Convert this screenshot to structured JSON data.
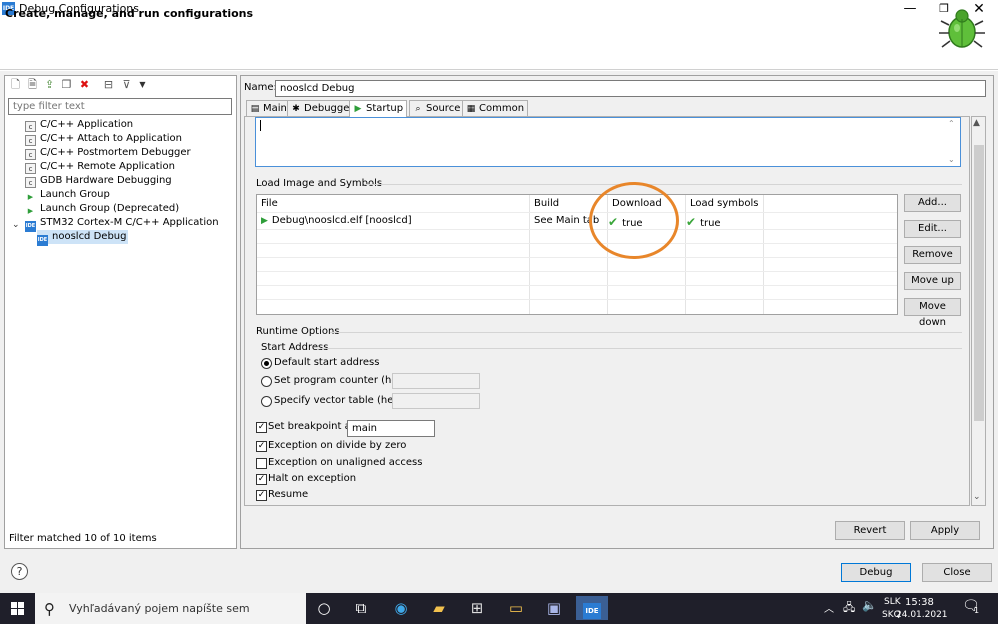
{
  "window": {
    "title": "Debug Configurations",
    "banner_title": "Create, manage, and run configurations",
    "min_glyph": "—",
    "max_glyph": "❐",
    "close_glyph": "✕"
  },
  "left": {
    "filter_placeholder": "type filter text",
    "tree": [
      {
        "label": "C/C++ Application",
        "icon": "c-config-icon"
      },
      {
        "label": "C/C++ Attach to Application",
        "icon": "c-config-icon"
      },
      {
        "label": "C/C++ Postmortem Debugger",
        "icon": "c-config-icon"
      },
      {
        "label": "C/C++ Remote Application",
        "icon": "c-config-icon"
      },
      {
        "label": "GDB Hardware Debugging",
        "icon": "c-config-icon"
      },
      {
        "label": "Launch Group",
        "icon": "launch-icon"
      },
      {
        "label": "Launch Group (Deprecated)",
        "icon": "launch-icon"
      },
      {
        "label": "STM32 Cortex-M C/C++ Application",
        "icon": "ide-icon"
      },
      {
        "label": "nooslcd Debug",
        "icon": "ide-icon"
      }
    ],
    "status": "Filter matched 10 of 10 items"
  },
  "right": {
    "name_label": "Name:",
    "name_value": "nooslcd Debug",
    "tabs": [
      {
        "label": "Main",
        "icon": "main-icon"
      },
      {
        "label": "Debugger",
        "icon": "debugger-icon"
      },
      {
        "label": "Startup",
        "icon": "startup-icon"
      },
      {
        "label": "Source",
        "icon": "source-icon"
      },
      {
        "label": "Common",
        "icon": "common-icon"
      }
    ],
    "active_tab": "Startup",
    "load_image": {
      "group_title": "Load Image and Symbols",
      "headers": [
        "File",
        "Build",
        "Download",
        "Load symbols"
      ],
      "rows": [
        {
          "file": "Debug\\nooslcd.elf [nooslcd]",
          "build": "See Main tab",
          "download": "true",
          "load_symbols": "true"
        }
      ],
      "buttons": [
        "Add...",
        "Edit...",
        "Remove",
        "Move up",
        "Move down"
      ]
    },
    "runtime": {
      "group_title": "Runtime Options",
      "start_address_title": "Start Address",
      "radios": [
        {
          "label": "Default start address",
          "selected": true
        },
        {
          "label": "Set program counter (hex):",
          "selected": false
        },
        {
          "label": "Specify vector table (hex):",
          "selected": false
        }
      ],
      "breakpoint_label": "Set breakpoint at:",
      "breakpoint_value": "main",
      "checkboxes": [
        {
          "label": "Exception on divide by zero",
          "checked": true
        },
        {
          "label": "Exception on unaligned access",
          "checked": false
        },
        {
          "label": "Halt on exception",
          "checked": true
        },
        {
          "label": "Resume",
          "checked": true
        }
      ]
    },
    "revert_label": "Revert",
    "apply_label": "Apply"
  },
  "footer": {
    "debug_label": "Debug",
    "close_label": "Close",
    "help_glyph": "?"
  },
  "taskbar": {
    "search_placeholder": "Vyhľadávaný pojem napíšte sem",
    "lang_top": "SLK",
    "lang_bottom": "SKQ",
    "time": "15:38",
    "date": "24.01.2021",
    "notification_count": "1"
  },
  "colors": {
    "accent": "#0078d7",
    "highlight_circle": "#e8862a",
    "check_green": "#3aa63a",
    "selection": "#cde3f7"
  }
}
